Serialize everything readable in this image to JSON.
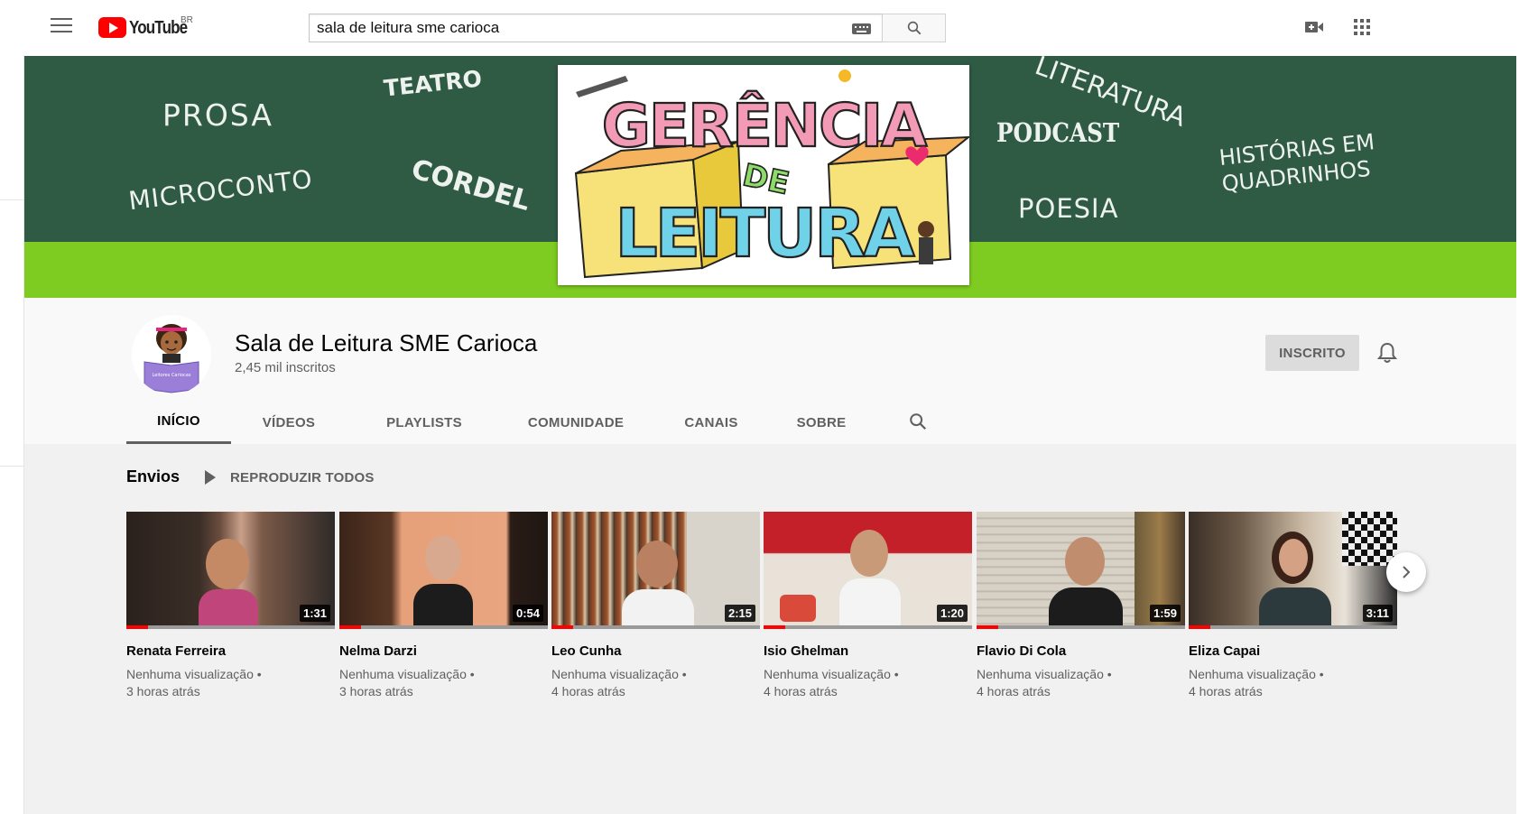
{
  "topbar": {
    "logo_text": "YouTube",
    "country_code": "BR",
    "search_value": "sala de leitura sme carioca",
    "icons": [
      "menu-icon",
      "keyboard-icon",
      "search-icon",
      "create-video-icon",
      "apps-icon"
    ]
  },
  "banner": {
    "words": {
      "prosa": "PROSA",
      "teatro": "TEATRO",
      "microconto": "MICROCONTO",
      "cordel": "CORDEL",
      "literatura": "LITERATURA",
      "podcast": "PODCAST",
      "poesia": "POESIA",
      "hq_line1": "HISTÓRIAS EM",
      "hq_line2": "QUADRINHOS"
    },
    "art_title_line1": "GERÊNCIA",
    "art_title_line2": "DE",
    "art_title_line3": "LEITURA",
    "colors": {
      "dark_green": "#2f5b45",
      "lime": "#7ecb22"
    }
  },
  "channel": {
    "name": "Sala de Leitura SME Carioca",
    "subscribers": "2,45 mil inscritos",
    "subscribed_label": "INSCRITO",
    "avatar_text": "Leitores Cariocas"
  },
  "tabs": [
    {
      "label": "INÍCIO",
      "active": true
    },
    {
      "label": "VÍDEOS",
      "active": false
    },
    {
      "label": "PLAYLISTS",
      "active": false
    },
    {
      "label": "COMUNIDADE",
      "active": false
    },
    {
      "label": "CANAIS",
      "active": false
    },
    {
      "label": "SOBRE",
      "active": false
    }
  ],
  "uploads": {
    "title": "Envios",
    "play_all": "REPRODUZIR TODOS",
    "videos": [
      {
        "title": "Renata Ferreira",
        "duration": "1:31",
        "views": "Nenhuma visualização •",
        "age": "3 horas atrás"
      },
      {
        "title": "Nelma Darzi",
        "duration": "0:54",
        "views": "Nenhuma visualização •",
        "age": "3 horas atrás"
      },
      {
        "title": "Leo Cunha",
        "duration": "2:15",
        "views": "Nenhuma visualização •",
        "age": "4 horas atrás"
      },
      {
        "title": "Isio Ghelman",
        "duration": "1:20",
        "views": "Nenhuma visualização •",
        "age": "4 horas atrás"
      },
      {
        "title": "Flavio Di Cola",
        "duration": "1:59",
        "views": "Nenhuma visualização •",
        "age": "4 horas atrás"
      },
      {
        "title": "Eliza Capai",
        "duration": "3:11",
        "views": "Nenhuma visualização •",
        "age": "4 horas atrás"
      }
    ]
  }
}
